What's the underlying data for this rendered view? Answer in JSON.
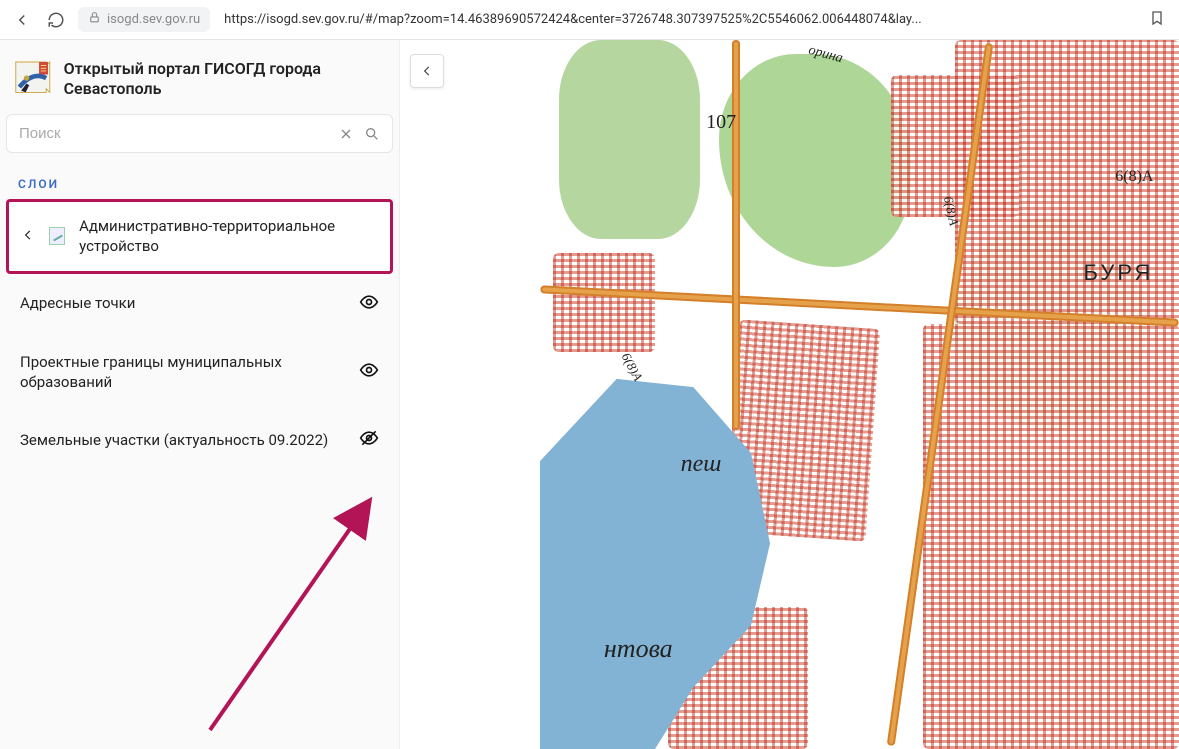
{
  "browser": {
    "domain": "isogd.sev.gov.ru",
    "url_display": "https://isogd.sev.gov.ru/#/map?zoom=14.46389690572424&center=3726748.307397525%2C5546062.006448074&lay..."
  },
  "app_title": "Открытый портал ГИСОГД города Севастополь",
  "search": {
    "placeholder": "Поиск",
    "value": ""
  },
  "tab_label": "СЛОИ",
  "active_group": {
    "label": "Административно-территориальное устройство"
  },
  "layers": [
    {
      "label": "Адресные точки",
      "visible": true
    },
    {
      "label": "Проектные границы муниципальных образований",
      "visible": true
    },
    {
      "label": "Земельные участки (актуальность 09.2022)",
      "visible": false
    }
  ],
  "map_labels": {
    "num107": "107",
    "burya": "БУРЯ",
    "pesh": "пеш",
    "ntova": "нтова",
    "six8a_1": "6(8)А",
    "six8a_2": "6(8)А",
    "six8a_3": "6(8)А",
    "orina": "орина"
  },
  "colors": {
    "highlight_border": "#b31456",
    "arrow": "#b31456",
    "link": "#3a6cc7",
    "sea": "#82b2d4",
    "green": "#9fcf85",
    "road": "#e6a24a",
    "parcel": "#e28a7d"
  }
}
